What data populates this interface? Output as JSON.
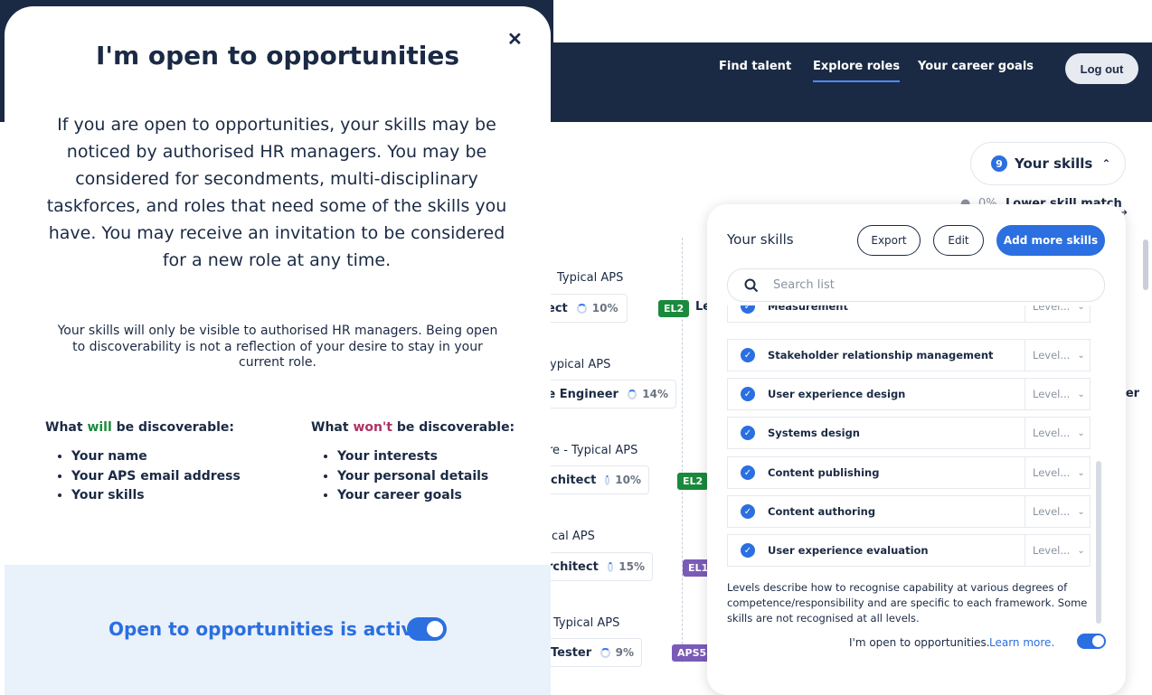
{
  "nav": {
    "links": [
      "Find talent",
      "Explore roles",
      "Your career goals"
    ],
    "logout_label": "Log out"
  },
  "skills_button": {
    "count": "9",
    "label": "Your skills"
  },
  "background": {
    "match_percent": "0%",
    "match_label": "Lower skill match",
    "role_groups": [
      {
        "label": "Typical APS",
        "card": "ect",
        "pct": "10%",
        "badge": "EL2",
        "badge_tail": "Le"
      },
      {
        "label": "ypical APS",
        "card": "re Engineer",
        "pct": "14%"
      },
      {
        "label": "re - Typical APS",
        "card": "chitect",
        "pct": "10%",
        "badge": "EL2"
      },
      {
        "label": "cal APS",
        "card": "rchitect",
        "pct": "15%",
        "badge": "EL1"
      },
      {
        "label": "Typical APS",
        "card": "Tester",
        "pct": "9%",
        "badge": "APS5"
      }
    ],
    "right_fragment": "eer"
  },
  "skills_panel": {
    "title": "Your skills",
    "export_label": "Export",
    "edit_label": "Edit",
    "add_label": "Add more skills",
    "search_placeholder": "Search list",
    "level_placeholder": "Level...",
    "skills": [
      "Measurement",
      "Stakeholder relationship management",
      "User experience design",
      "Systems design",
      "Content publishing",
      "Content authoring",
      "User experience evaluation"
    ],
    "note": "Levels describe how to recognise capability at various degrees of competence/responsibility and are specific to each framework. Some skills are not recognised at all levels.",
    "open_label": "I'm open to opportunities.",
    "learn_more": "Learn more.",
    "open_toggle": true
  },
  "modal": {
    "title": "I'm open to opportunities",
    "lead": "If you are open to opportunities, your skills may be noticed by authorised HR managers. You may be considered for secondments, multi-disciplinary taskforces, and roles that need some of the skills you have. You may receive an invitation to be considered for a new role at any time.",
    "small": "Your skills will only be visible to authorised HR managers. Being open to discoverability is not a reflection of your desire to stay in your current role.",
    "will": {
      "prefix": "What",
      "keyword": "will",
      "suffix": "be discoverable:",
      "items": [
        "Your name",
        "Your APS email address",
        "Your skills"
      ]
    },
    "wont": {
      "prefix": "What",
      "keyword": "won't",
      "suffix": "be discoverable:",
      "items": [
        "Your interests",
        "Your personal details",
        "Your career goals"
      ]
    },
    "footer_text": "Open to opportunities is active",
    "footer_toggle": true,
    "colors": {
      "primary": "#2b6fe0",
      "navy": "#1b2a44",
      "will": "#1a8a3c",
      "wont": "#b03060",
      "footer_bg": "#e9f1fb"
    }
  }
}
